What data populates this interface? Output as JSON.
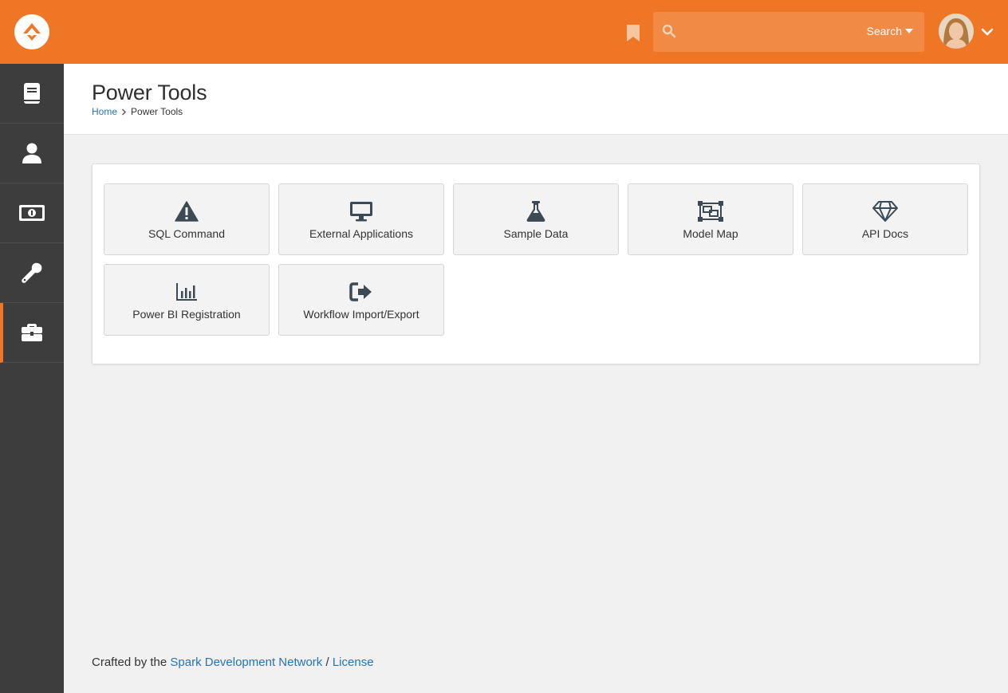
{
  "header": {
    "search_placeholder": "",
    "search_button_label": "Search"
  },
  "sidebar": {
    "items": [
      {
        "name": "book"
      },
      {
        "name": "user"
      },
      {
        "name": "money"
      },
      {
        "name": "wrench"
      },
      {
        "name": "briefcase",
        "active": true
      }
    ]
  },
  "page": {
    "title": "Power Tools",
    "breadcrumb": {
      "home": "Home",
      "current": "Power Tools"
    }
  },
  "tools": [
    {
      "label": "SQL Command",
      "icon": "warning-icon"
    },
    {
      "label": "External Applications",
      "icon": "desktop-icon"
    },
    {
      "label": "Sample Data",
      "icon": "flask-icon"
    },
    {
      "label": "Model Map",
      "icon": "object-group-icon"
    },
    {
      "label": "API Docs",
      "icon": "gem-icon"
    },
    {
      "label": "Power BI Registration",
      "icon": "bar-chart-icon"
    },
    {
      "label": "Workflow Import/Export",
      "icon": "sign-out-icon"
    }
  ],
  "footer": {
    "prefix": "Crafted by the",
    "network_link": "Spark Development Network",
    "separator": "/",
    "license_link": "License"
  },
  "colors": {
    "accent": "#ee7624",
    "sidebar": "#3d3d3d",
    "link": "#2774b5"
  }
}
